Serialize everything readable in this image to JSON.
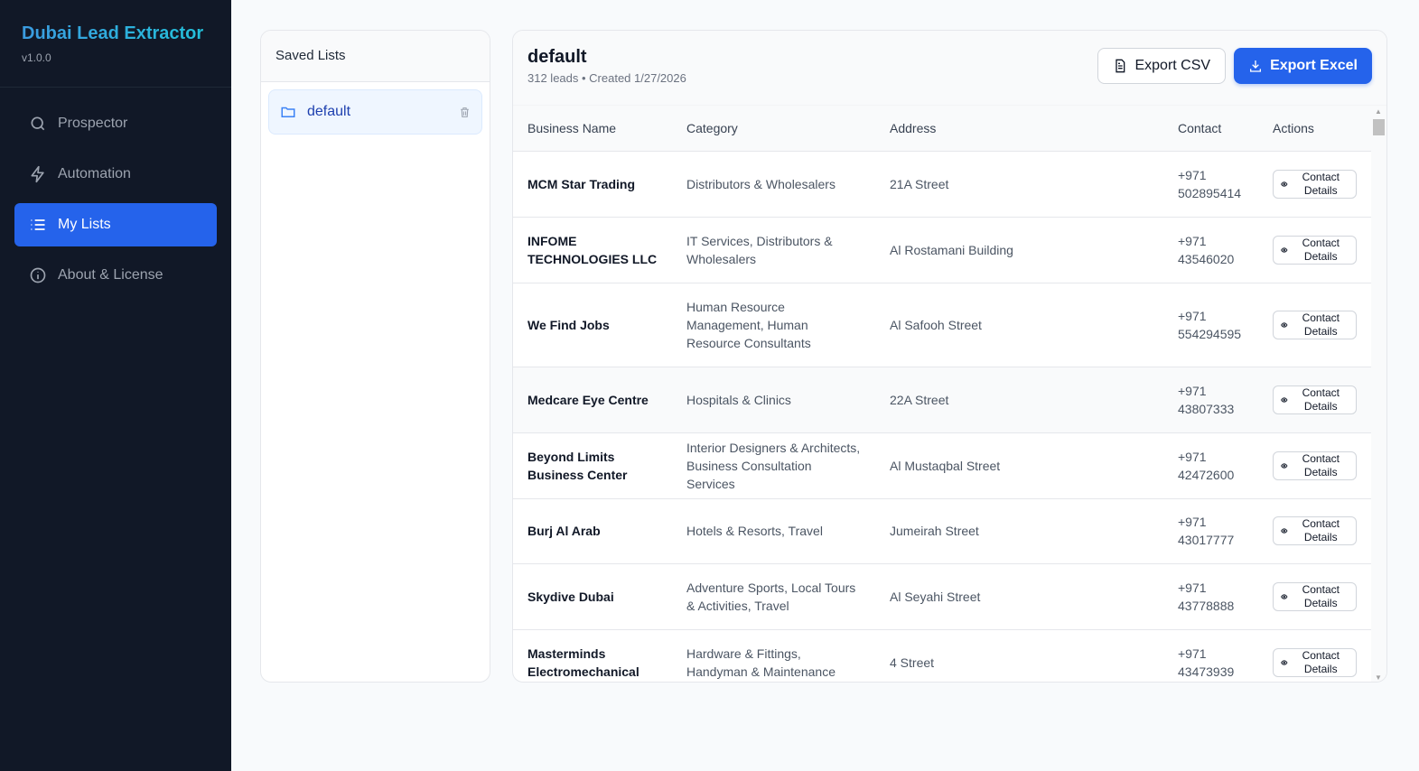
{
  "app": {
    "title": "Dubai Lead Extractor",
    "version": "v1.0.0"
  },
  "nav": [
    {
      "label": "Prospector",
      "icon": "search-icon"
    },
    {
      "label": "Automation",
      "icon": "bolt-icon"
    },
    {
      "label": "My Lists",
      "icon": "list-icon",
      "active": true
    },
    {
      "label": "About & License",
      "icon": "info-icon"
    }
  ],
  "saved_lists": {
    "title": "Saved Lists",
    "items": [
      {
        "label": "default"
      }
    ]
  },
  "list": {
    "title": "default",
    "subtitle": "312 leads • Created 1/27/2026",
    "export_csv": "Export CSV",
    "export_excel": "Export Excel"
  },
  "table": {
    "headers": [
      "Business Name",
      "Category",
      "Address",
      "Contact",
      "Actions"
    ],
    "action_label": "Contact Details",
    "rows": [
      {
        "name": "MCM Star Trading",
        "category": "Distributors & Wholesalers",
        "address": "21A Street",
        "contact": "+971 502895414"
      },
      {
        "name": "INFOME TECHNOLOGIES LLC",
        "category": "IT Services, Distributors & Wholesalers",
        "address": "Al Rostamani Building",
        "contact": "+971 43546020"
      },
      {
        "name": "We Find Jobs",
        "category": "Human Resource Management, Human Resource Consultants",
        "address": "Al Safooh Street",
        "contact": "+971 554294595"
      },
      {
        "name": "Medcare Eye Centre",
        "category": "Hospitals & Clinics",
        "address": "22A Street",
        "contact": "+971 43807333"
      },
      {
        "name": "Beyond Limits Business Center",
        "category": "Interior Designers & Architects, Business Consultation Services",
        "address": "Al Mustaqbal Street",
        "contact": "+971 42472600"
      },
      {
        "name": "Burj Al Arab",
        "category": "Hotels & Resorts, Travel",
        "address": "Jumeirah Street",
        "contact": "+971 43017777"
      },
      {
        "name": "Skydive Dubai",
        "category": "Adventure Sports, Local Tours & Activities, Travel",
        "address": "Al Seyahi Street",
        "contact": "+971 43778888"
      },
      {
        "name": "Masterminds Electromechanical",
        "category": "Hardware & Fittings, Handyman & Maintenance",
        "address": "4 Street",
        "contact": "+971 43473939"
      }
    ]
  }
}
